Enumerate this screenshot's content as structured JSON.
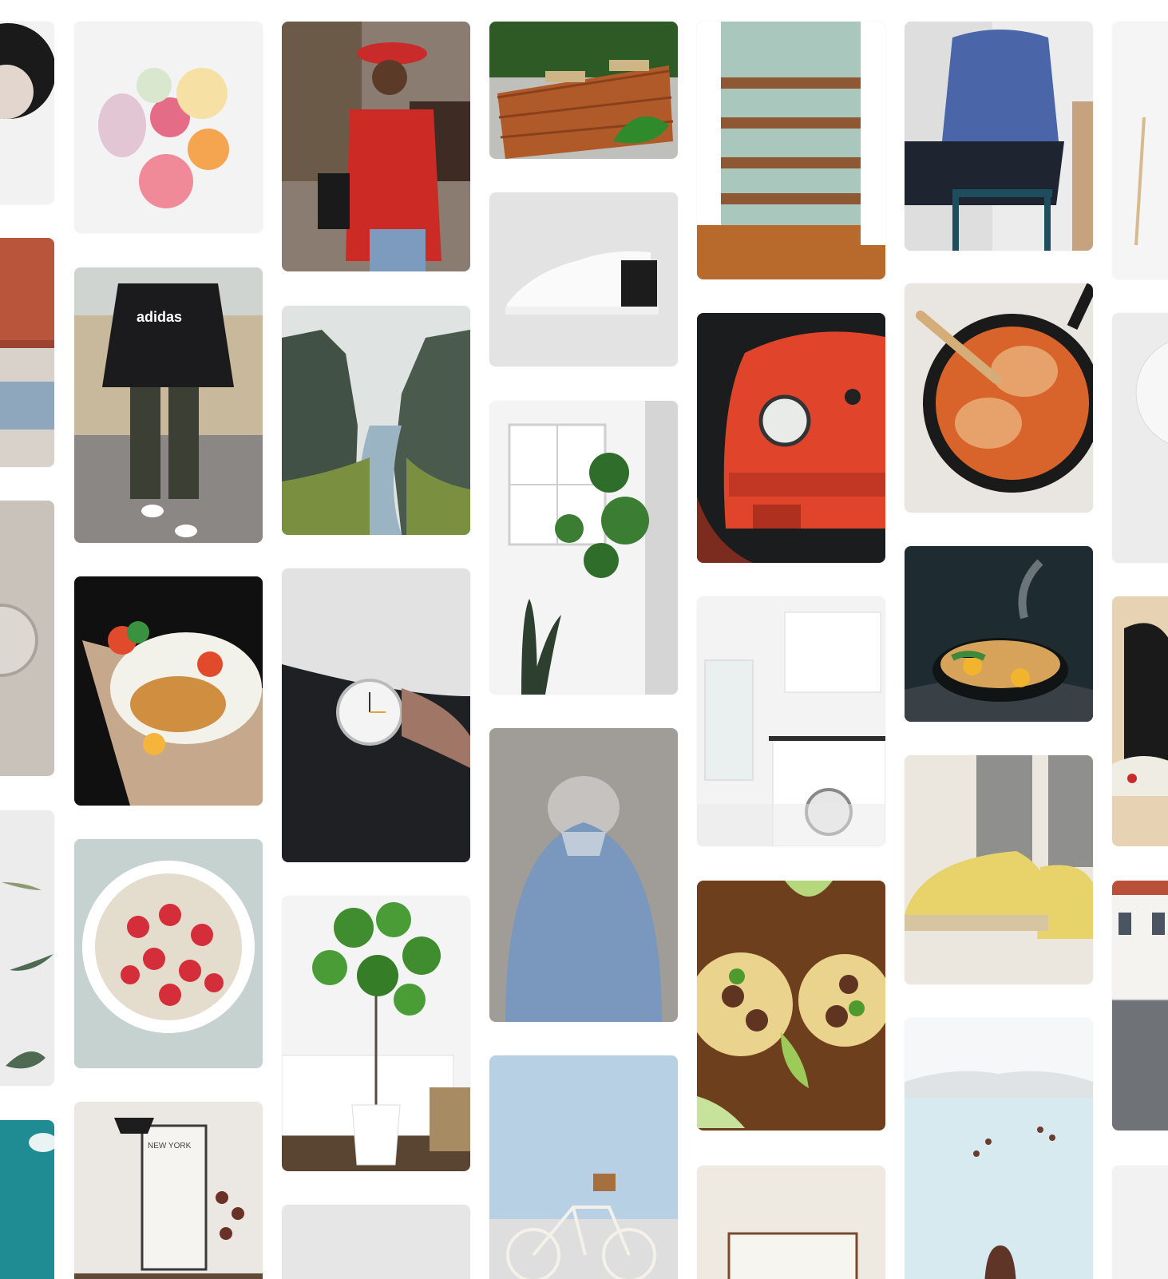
{
  "gallery": {
    "logo_text": "adidas",
    "poster_text": "NEW YORK",
    "pins": [
      "woman-black-hat",
      "red-wall",
      "watch-grey",
      "plant-leaves",
      "teal-sky",
      "ice-cream-cups",
      "adidas-hoodie-man",
      "fish-taco",
      "strawberry-oats",
      "new-york-desk",
      "red-sweater-woman",
      "canyon-river",
      "wrist-watch",
      "fiddle-leaf-fig",
      "grey-bottom",
      "wooden-bench",
      "white-sneaker",
      "bathroom-plants",
      "denim-jacket",
      "white-bicycle",
      "wood-shelves",
      "red-porsche",
      "white-kitchen",
      "tacos",
      "framed-art",
      "blue-jacket-man",
      "chicken-skillet",
      "ramen-bowl",
      "yellow-sneakers",
      "hot-spring",
      "white-chair",
      "white-plate",
      "converse-sneaker",
      "street-buildings",
      "white-bottom"
    ]
  }
}
